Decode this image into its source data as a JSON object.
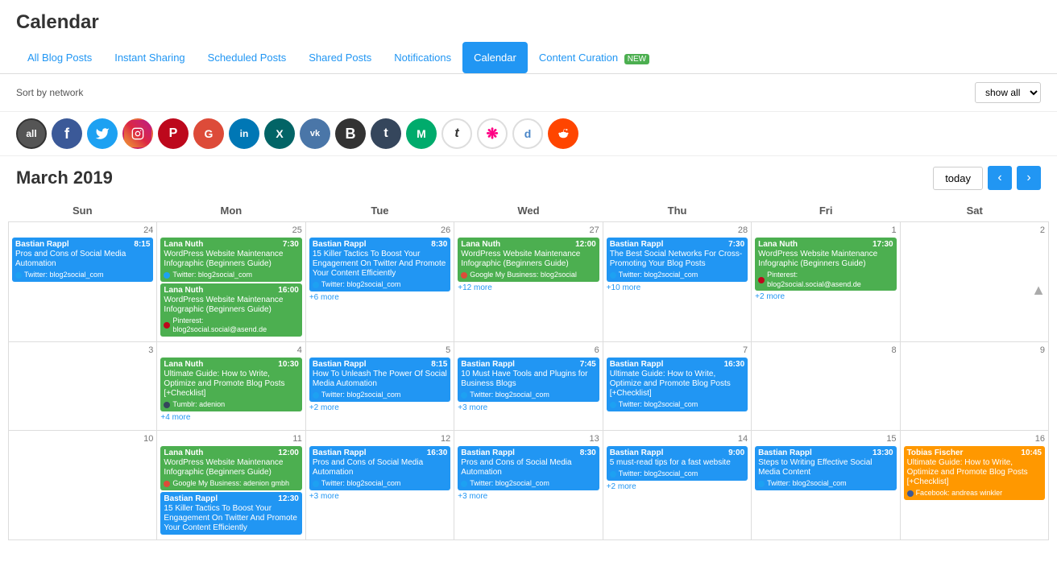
{
  "page": {
    "title": "Calendar"
  },
  "tabs": [
    {
      "id": "all-blog-posts",
      "label": "All Blog Posts",
      "active": false
    },
    {
      "id": "instant-sharing",
      "label": "Instant Sharing",
      "active": false
    },
    {
      "id": "scheduled-posts",
      "label": "Scheduled Posts",
      "active": false
    },
    {
      "id": "shared-posts",
      "label": "Shared Posts",
      "active": false
    },
    {
      "id": "notifications",
      "label": "Notifications",
      "active": false
    },
    {
      "id": "calendar",
      "label": "Calendar",
      "active": true
    },
    {
      "id": "content-curation",
      "label": "Content Curation",
      "active": false,
      "badge": "NEW"
    }
  ],
  "filter": {
    "sort_label": "Sort by network",
    "show_all": "show all"
  },
  "networks": [
    {
      "id": "all",
      "label": "all",
      "class": "net-all",
      "active": true
    },
    {
      "id": "facebook",
      "label": "f",
      "class": "net-fb"
    },
    {
      "id": "twitter",
      "label": "🐦",
      "class": "net-tw"
    },
    {
      "id": "instagram",
      "label": "📷",
      "class": "net-ig"
    },
    {
      "id": "pinterest",
      "label": "P",
      "class": "net-pi"
    },
    {
      "id": "google",
      "label": "G",
      "class": "net-gp"
    },
    {
      "id": "linkedin",
      "label": "in",
      "class": "net-li"
    },
    {
      "id": "xing",
      "label": "X",
      "class": "net-xing"
    },
    {
      "id": "vk",
      "label": "vk",
      "class": "net-vk"
    },
    {
      "id": "blogger",
      "label": "B",
      "class": "net-b"
    },
    {
      "id": "tumblr",
      "label": "t",
      "class": "net-tumblr"
    },
    {
      "id": "medium",
      "label": "M",
      "class": "net-medium"
    },
    {
      "id": "typepad",
      "label": "t",
      "class": "net-t"
    },
    {
      "id": "flickr",
      "label": "❋",
      "class": "net-flickr"
    },
    {
      "id": "delicious",
      "label": "d",
      "class": "net-d"
    },
    {
      "id": "reddit",
      "label": "👽",
      "class": "net-reddit"
    }
  ],
  "calendar": {
    "month_title": "March 2019",
    "today_label": "today",
    "day_headers": [
      "Sun",
      "Mon",
      "Tue",
      "Wed",
      "Thu",
      "Fri",
      "Sat"
    ],
    "weeks": [
      {
        "days": [
          {
            "num": "",
            "events": []
          },
          {
            "num": "",
            "events": []
          },
          {
            "num": "",
            "events": []
          },
          {
            "num": "",
            "events": []
          },
          {
            "num": "",
            "events": []
          },
          {
            "num": 1,
            "events": [
              {
                "color": "green",
                "author": "Lana Nuth",
                "time": "17:30",
                "title": "WordPress Website Maintenance Infographic (Beginners Guide)",
                "account_icon": "pi",
                "account": "Pinterest: blog2social.social@asend.de"
              }
            ],
            "more": "+2 more"
          },
          {
            "num": 2,
            "events": []
          }
        ]
      },
      {
        "days": [
          {
            "num": 24,
            "events": [
              {
                "color": "blue",
                "author": "Bastian Rappl",
                "time": "8:15",
                "title": "Pros and Cons of Social Media Automation",
                "account_icon": "tw",
                "account": "Twitter: blog2social_com"
              }
            ]
          },
          {
            "num": 25,
            "events": [
              {
                "color": "green",
                "author": "Lana Nuth",
                "time": "7:30",
                "title": "WordPress Website Maintenance Infographic (Beginners Guide)",
                "account_icon": "tw",
                "account": "Twitter: blog2social_com"
              },
              {
                "color": "green",
                "author": "Lana Nuth",
                "time": "16:00",
                "title": "WordPress Website Maintenance Infographic (Beginners Guide)",
                "account_icon": "pi",
                "account": "Pinterest: blog2social.social@asend.de"
              }
            ]
          },
          {
            "num": 26,
            "events": [
              {
                "color": "blue",
                "author": "Bastian Rappl",
                "time": "8:30",
                "title": "15 Killer Tactics To Boost Your Engagement On Twitter And Promote Your Content Efficiently",
                "account_icon": "tw",
                "account": "Twitter: blog2social_com"
              }
            ],
            "more": "+6 more"
          },
          {
            "num": 27,
            "events": [
              {
                "color": "green",
                "author": "Lana Nuth",
                "time": "12:00",
                "title": "WordPress Website Maintenance Infographic (Beginners Guide)",
                "account_icon": "gm",
                "account": "Google My Business: blog2social"
              }
            ],
            "more": "+12 more"
          },
          {
            "num": 28,
            "events": [
              {
                "color": "blue",
                "author": "Bastian Rappl",
                "time": "7:30",
                "title": "The Best Social Networks For Cross-Promoting Your Blog Posts",
                "account_icon": "tw",
                "account": "Twitter: blog2social_com"
              }
            ],
            "more": "+10 more"
          },
          {
            "num": 1,
            "events": [
              {
                "color": "green",
                "author": "Lana Nuth",
                "time": "17:30",
                "title": "WordPress Website Maintenance Infographic (Beginners Guide)",
                "account_icon": "pi",
                "account": "Pinterest: blog2social.social@asend.de"
              }
            ],
            "more": "+2 more"
          },
          {
            "num": 2,
            "events": []
          }
        ]
      },
      {
        "days": [
          {
            "num": 3,
            "events": []
          },
          {
            "num": 4,
            "events": [
              {
                "color": "green",
                "author": "Lana Nuth",
                "time": "10:30",
                "title": "Ultimate Guide: How to Write, Optimize and Promote Blog Posts [+Checklist]",
                "account_icon": "tumblr",
                "account": "Tumblr: adenion"
              }
            ],
            "more": "+4 more"
          },
          {
            "num": 5,
            "events": [
              {
                "color": "blue",
                "author": "Bastian Rappl",
                "time": "8:15",
                "title": "How To Unleash The Power Of Social Media Automation",
                "account_icon": "tw",
                "account": "Twitter: blog2social_com"
              }
            ],
            "more": "+2 more"
          },
          {
            "num": 6,
            "events": [
              {
                "color": "blue",
                "author": "Bastian Rappl",
                "time": "7:45",
                "title": "10 Must Have Tools and Plugins for Business Blogs",
                "account_icon": "tw",
                "account": "Twitter: blog2social_com"
              }
            ],
            "more": "+3 more"
          },
          {
            "num": 7,
            "events": [
              {
                "color": "blue",
                "author": "Bastian Rappl",
                "time": "16:30",
                "title": "Ultimate Guide: How to Write, Optimize and Promote Blog Posts [+Checklist]",
                "account_icon": "tw",
                "account": "Twitter: blog2social_com"
              }
            ]
          },
          {
            "num": 8,
            "events": []
          },
          {
            "num": 9,
            "events": []
          }
        ]
      },
      {
        "days": [
          {
            "num": 10,
            "events": []
          },
          {
            "num": 11,
            "events": [
              {
                "color": "green",
                "author": "Lana Nuth",
                "time": "12:00",
                "title": "WordPress Website Maintenance Infographic (Beginners Guide)",
                "account_icon": "gm",
                "account": "Google My Business: adenion gmbh"
              },
              {
                "color": "blue",
                "author": "Bastian Rappl",
                "time": "12:30",
                "title": "15 Killer Tactics To Boost Your Engagement On Twitter And Promote Your Content Efficiently",
                "account_icon": "tw",
                "account": ""
              }
            ]
          },
          {
            "num": 12,
            "events": [
              {
                "color": "blue",
                "author": "Bastian Rappl",
                "time": "16:30",
                "title": "Pros and Cons of Social Media Automation",
                "account_icon": "tw",
                "account": "Twitter: blog2social_com"
              }
            ],
            "more": "+3 more"
          },
          {
            "num": 13,
            "events": [
              {
                "color": "blue",
                "author": "Bastian Rappl",
                "time": "8:30",
                "title": "Pros and Cons of Social Media Automation",
                "account_icon": "tw",
                "account": "Twitter: blog2social_com"
              }
            ],
            "more": "+3 more"
          },
          {
            "num": 14,
            "events": [
              {
                "color": "blue",
                "author": "Bastian Rappl",
                "time": "9:00",
                "title": "5 must-read tips for a fast website",
                "account_icon": "tw",
                "account": "Twitter: blog2social_com"
              }
            ],
            "more": "+2 more"
          },
          {
            "num": 15,
            "events": [
              {
                "color": "blue",
                "author": "Bastian Rappl",
                "time": "13:30",
                "title": "Steps to Writing Effective Social Media Content",
                "account_icon": "tw",
                "account": "Twitter: blog2social_com"
              }
            ]
          },
          {
            "num": 16,
            "events": [
              {
                "color": "orange",
                "author": "Tobias Fischer",
                "time": "10:45",
                "title": "Ultimate Guide: How to Write, Optimize and Promote Blog Posts [+Checklist]",
                "account_icon": "fb",
                "account": "Facebook: andreas winkler"
              }
            ]
          }
        ]
      }
    ]
  }
}
